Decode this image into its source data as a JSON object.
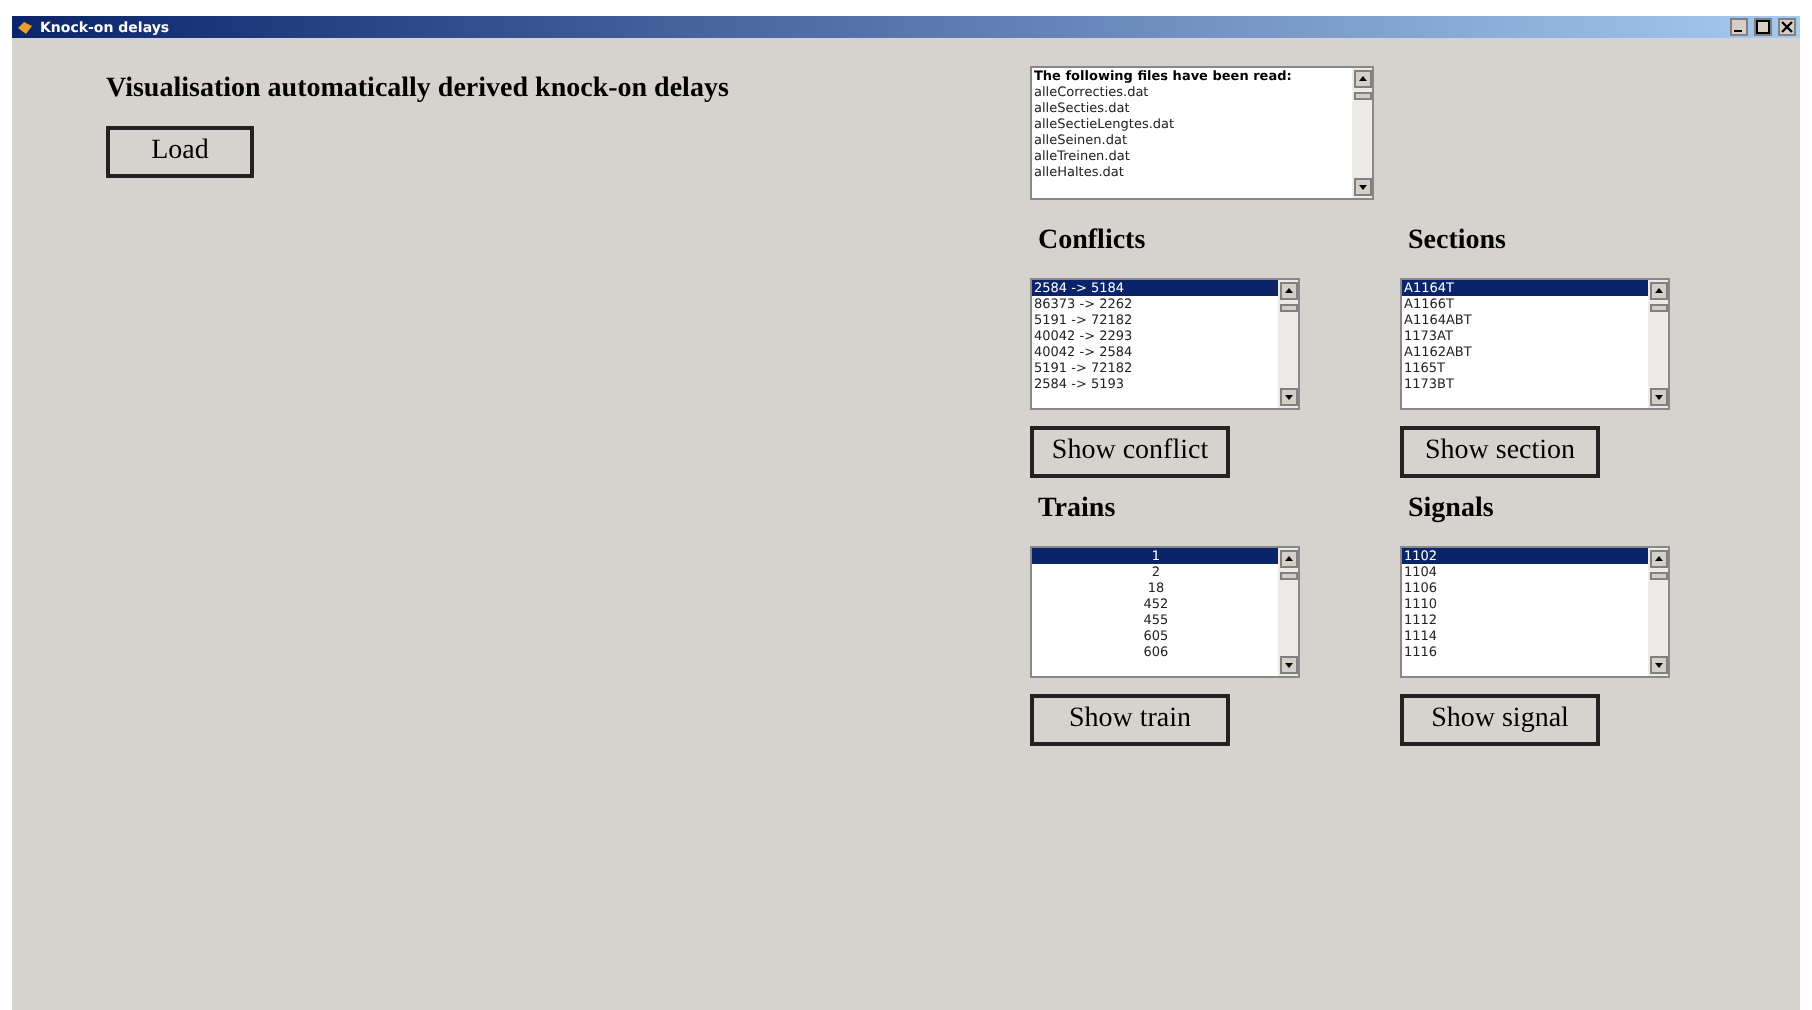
{
  "window": {
    "title": "Knock-on delays"
  },
  "heading": "Visualisation automatically derived knock-on delays",
  "load_button": "Load",
  "files_list": {
    "header": "The following files have been read:",
    "items": [
      "alleCorrecties.dat",
      "alleSecties.dat",
      "alleSectieLengtes.dat",
      "alleSeinen.dat",
      "alleTreinen.dat",
      "alleHaltes.dat"
    ]
  },
  "panels": [
    {
      "title": "Conflicts",
      "button": "Show conflict",
      "kind": "text",
      "items": [
        {
          "label": "2584 -> 5184",
          "selected": true
        },
        {
          "label": "86373 -> 2262",
          "selected": false
        },
        {
          "label": "5191 -> 72182",
          "selected": false
        },
        {
          "label": "40042 -> 2293",
          "selected": false
        },
        {
          "label": "40042 -> 2584",
          "selected": false
        },
        {
          "label": "5191 -> 72182",
          "selected": false
        },
        {
          "label": "2584 -> 5193",
          "selected": false
        }
      ]
    },
    {
      "title": "Sections",
      "button": "Show section",
      "kind": "text",
      "items": [
        {
          "label": "A1164T",
          "selected": true
        },
        {
          "label": "A1166T",
          "selected": false
        },
        {
          "label": "A1164ABT",
          "selected": false
        },
        {
          "label": "1173AT",
          "selected": false
        },
        {
          "label": "A1162ABT",
          "selected": false
        },
        {
          "label": "1165T",
          "selected": false
        },
        {
          "label": "1173BT",
          "selected": false
        }
      ]
    },
    {
      "title": "Trains",
      "button": "Show train",
      "kind": "numeric",
      "items": [
        {
          "label": "1",
          "selected": true
        },
        {
          "label": "2",
          "selected": false
        },
        {
          "label": "18",
          "selected": false
        },
        {
          "label": "452",
          "selected": false
        },
        {
          "label": "455",
          "selected": false
        },
        {
          "label": "605",
          "selected": false
        },
        {
          "label": "606",
          "selected": false
        }
      ]
    },
    {
      "title": "Signals",
      "button": "Show signal",
      "kind": "text",
      "items": [
        {
          "label": "1102",
          "selected": true
        },
        {
          "label": "1104",
          "selected": false
        },
        {
          "label": "1106",
          "selected": false
        },
        {
          "label": "1110",
          "selected": false
        },
        {
          "label": "1112",
          "selected": false
        },
        {
          "label": "1114",
          "selected": false
        },
        {
          "label": "1116",
          "selected": false
        }
      ]
    }
  ]
}
